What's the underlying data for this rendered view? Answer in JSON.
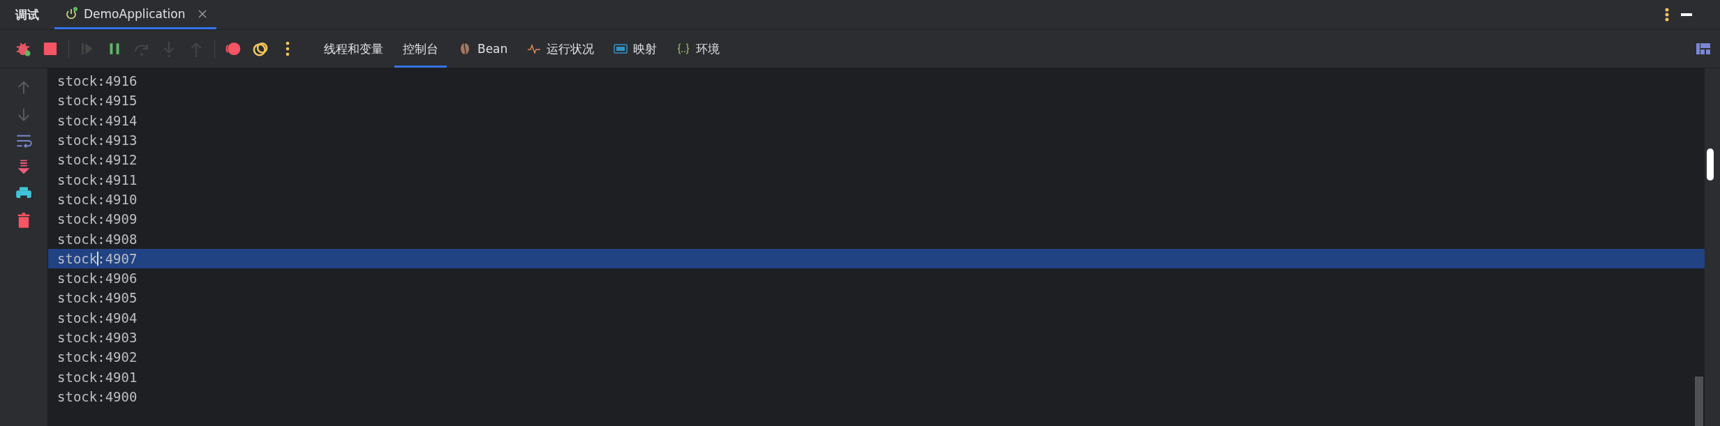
{
  "window": {
    "title": "调试"
  },
  "tabs": [
    {
      "label": "DemoApplication",
      "selected": true
    }
  ],
  "toolbar_buttons": [
    {
      "kind": "debug",
      "disabled": false
    },
    {
      "kind": "stop",
      "disabled": false
    },
    {
      "kind": "resume",
      "disabled": true
    },
    {
      "kind": "pause",
      "disabled": false
    },
    {
      "kind": "step-over",
      "disabled": true
    },
    {
      "kind": "step-into",
      "disabled": true
    },
    {
      "kind": "step-out",
      "disabled": true
    },
    {
      "kind": "breakpoints",
      "disabled": false
    },
    {
      "kind": "mute",
      "disabled": false
    },
    {
      "kind": "more",
      "disabled": false
    }
  ],
  "view_tabs": [
    {
      "label": "线程和变量",
      "kind": "plain",
      "selected": false
    },
    {
      "label": "控制台",
      "kind": "plain",
      "selected": true
    },
    {
      "label": "Bean",
      "kind": "bean",
      "selected": false
    },
    {
      "label": "运行状况",
      "kind": "health",
      "selected": false
    },
    {
      "label": "映射",
      "kind": "api",
      "selected": false
    },
    {
      "label": "环境",
      "kind": "env",
      "selected": false
    }
  ],
  "console": {
    "lines": [
      {
        "text": "stock:4916",
        "selected": false
      },
      {
        "text": "stock:4915",
        "selected": false
      },
      {
        "text": "stock:4914",
        "selected": false
      },
      {
        "text": "stock:4913",
        "selected": false
      },
      {
        "text": "stock:4912",
        "selected": false
      },
      {
        "text": "stock:4911",
        "selected": false
      },
      {
        "text": "stock:4910",
        "selected": false
      },
      {
        "text": "stock:4909",
        "selected": false
      },
      {
        "text": "stock:4908",
        "selected": false
      },
      {
        "text": "stock:4907",
        "selected": true
      },
      {
        "text": "stock:4906",
        "selected": false
      },
      {
        "text": "stock:4905",
        "selected": false
      },
      {
        "text": "stock:4904",
        "selected": false
      },
      {
        "text": "stock:4903",
        "selected": false
      },
      {
        "text": "stock:4902",
        "selected": false
      },
      {
        "text": "stock:4901",
        "selected": false
      },
      {
        "text": "stock:4900",
        "selected": false
      }
    ]
  }
}
